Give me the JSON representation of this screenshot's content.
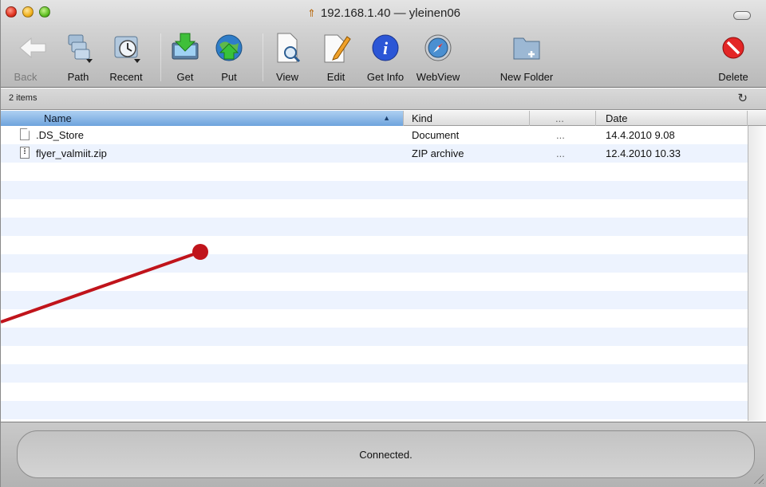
{
  "window": {
    "title": "192.168.1.40 — yleinen06"
  },
  "toolbar": {
    "items": [
      {
        "label": "Back",
        "icon": "back-arrow-icon"
      },
      {
        "label": "Path",
        "icon": "path-folders-icon"
      },
      {
        "label": "Recent",
        "icon": "recent-clock-icon"
      },
      {
        "label": "Get",
        "icon": "download-get-icon"
      },
      {
        "label": "Put",
        "icon": "upload-put-icon"
      },
      {
        "label": "View",
        "icon": "magnifier-document-icon"
      },
      {
        "label": "Edit",
        "icon": "pencil-document-icon"
      },
      {
        "label": "Get Info",
        "icon": "info-icon"
      },
      {
        "label": "WebView",
        "icon": "compass-icon"
      },
      {
        "label": "New Folder",
        "icon": "new-folder-icon"
      },
      {
        "label": "Delete",
        "icon": "delete-icon"
      }
    ]
  },
  "items_bar": {
    "count": "2 items"
  },
  "columns": {
    "name": "Name",
    "kind": "Kind",
    "more": "...",
    "date": "Date"
  },
  "files": [
    {
      "name": ".DS_Store",
      "kind": "Document",
      "more": "...",
      "date": "14.4.2010 9.08",
      "icon": "document-icon"
    },
    {
      "name": "flyer_valmiit.zip",
      "kind": "ZIP archive",
      "more": "...",
      "date": "12.4.2010 10.33",
      "icon": "zip-archive-icon"
    }
  ],
  "status": {
    "text": "Connected."
  },
  "colors": {
    "selection_header": "#6ea3dc",
    "alt_row": "#edf3fe",
    "annotation": "#c0141b"
  }
}
